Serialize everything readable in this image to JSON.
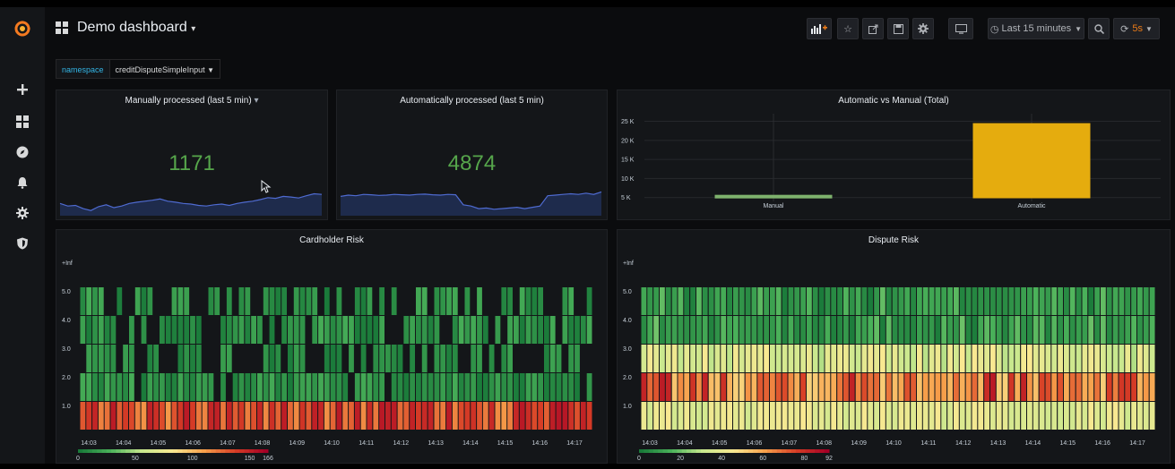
{
  "header": {
    "title": "Demo dashboard",
    "time_range": "Last 15 minutes",
    "refresh": "5s"
  },
  "variables": {
    "label": "namespace",
    "value": "creditDisputeSimpleInput"
  },
  "panels": {
    "manual": {
      "title": "Manually processed (last 5 min)",
      "value": "1171",
      "sparkline": [
        0.38,
        0.3,
        0.32,
        0.22,
        0.16,
        0.28,
        0.34,
        0.25,
        0.3,
        0.38,
        0.42,
        0.45,
        0.48,
        0.52,
        0.45,
        0.42,
        0.38,
        0.36,
        0.32,
        0.3,
        0.34,
        0.36,
        0.32,
        0.38,
        0.42,
        0.45,
        0.5,
        0.56,
        0.54,
        0.6,
        0.58,
        0.55,
        0.62,
        0.68,
        0.66
      ]
    },
    "auto": {
      "title": "Automatically processed (last 5 min)",
      "value": "4874",
      "sparkline": [
        0.6,
        0.64,
        0.62,
        0.66,
        0.65,
        0.63,
        0.64,
        0.66,
        0.65,
        0.64,
        0.66,
        0.67,
        0.65,
        0.64,
        0.66,
        0.65,
        0.34,
        0.3,
        0.22,
        0.24,
        0.2,
        0.22,
        0.24,
        0.26,
        0.22,
        0.26,
        0.3,
        0.62,
        0.64,
        0.66,
        0.68,
        0.66,
        0.7,
        0.66,
        0.74
      ]
    },
    "avm_title": "Automatic vs Manual (Total)",
    "cardholder_title": "Cardholder Risk",
    "dispute_title": "Dispute Risk"
  },
  "chart_data": [
    {
      "type": "bar",
      "title": "Automatic vs Manual (Total)",
      "categories": [
        "Manual",
        "Automatic"
      ],
      "values": [
        5600,
        24400
      ],
      "yticks": [
        "5 K",
        "10 K",
        "15 K",
        "20 K",
        "25 K"
      ],
      "ylim": [
        4000,
        27000
      ],
      "color": "#e5ac0e",
      "manual_color": "#7eb26d"
    },
    {
      "type": "heatmap",
      "title": "Cardholder Risk",
      "y_labels": [
        "1.0",
        "2.0",
        "3.0",
        "4.0",
        "5.0",
        "+Inf"
      ],
      "x_labels": [
        "14:03",
        "14:04",
        "14:05",
        "14:06",
        "14:07",
        "14:08",
        "14:09",
        "14:10",
        "14:11",
        "14:12",
        "14:13",
        "14:14",
        "14:15",
        "14:16",
        "14:17"
      ],
      "legend_ticks": [
        "0",
        "50",
        "100",
        "150",
        "166"
      ],
      "scale_max": 166
    },
    {
      "type": "heatmap",
      "title": "Dispute Risk",
      "y_labels": [
        "1.0",
        "2.0",
        "3.0",
        "4.0",
        "5.0",
        "+Inf"
      ],
      "x_labels": [
        "14:03",
        "14:04",
        "14:05",
        "14:06",
        "14:07",
        "14:08",
        "14:09",
        "14:10",
        "14:11",
        "14:12",
        "14:13",
        "14:14",
        "14:15",
        "14:16",
        "14:17"
      ],
      "legend_ticks": [
        "0",
        "20",
        "40",
        "60",
        "80",
        "92"
      ],
      "scale_max": 92
    }
  ]
}
